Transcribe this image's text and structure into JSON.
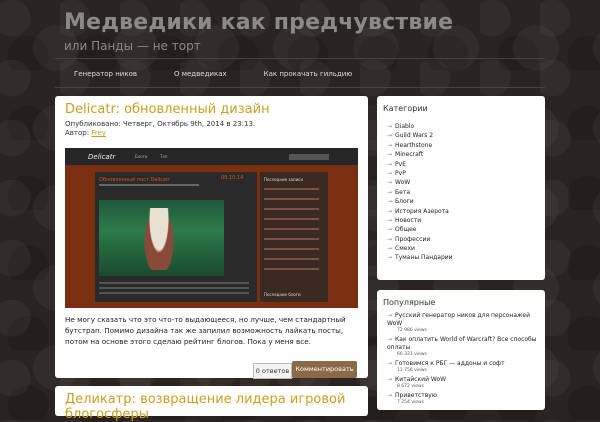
{
  "site": {
    "title": "Медведики как предчувствие",
    "description": "или Панды — не торт"
  },
  "nav": {
    "items": [
      "Генератор ников",
      "О медведиках",
      "Как прокачать гильдию"
    ]
  },
  "post1": {
    "title": "Delicatr: обновленный дизайн",
    "meta_published": "Опубликовано: Четверг, Октябрь 9th, 2014 в 23:13.",
    "meta_author_label": "Автор:",
    "meta_author": "Frey",
    "excerpt": "Не могу сказать что это что-то выдающееся, но лучше, чем стандартный бутстрап. Помимо дизайна так же запилил возможность лайкать посты, потом на основе этого сделаю рейтинг блогов. Пока у меня все.",
    "comments_count": "0 ответов",
    "comment_button": "Комментировать",
    "screenshot": {
      "logo": "Delicatr",
      "nav1": "Блоги",
      "nav2": "Топ",
      "title": "Обновленный пост Delicatr",
      "date": "09.10.14",
      "sidebar_head": "Последние записи",
      "sidebar_head2": "Последние блоги"
    }
  },
  "post2": {
    "title": "Деликатр: возвращение лидера игровой блогосферы"
  },
  "categories": {
    "title": "Категории",
    "items": [
      "Diablo",
      "Guild Wars 2",
      "Hearthstone",
      "Minecraft",
      "PvE",
      "PvP",
      "WoW",
      "Бета",
      "Блоги",
      "История Азерота",
      "Новости",
      "Общее",
      "Профессии",
      "Смехи",
      "Туманы Пандарии"
    ]
  },
  "popular": {
    "title": "Популярные",
    "items": [
      {
        "title": "Русский генератор ников для персонажей WoW",
        "views": "72 986 views"
      },
      {
        "title": "Как оплатить World of Warcraft? Все способы оплаты",
        "views": "66 321 views"
      },
      {
        "title": "Готовимся к РБГ — аддоны и софт",
        "views": "11 756 views"
      },
      {
        "title": "Китайский WoW",
        "views": "8 672 views"
      },
      {
        "title": "Приветствую",
        "views": "7 254 views"
      }
    ]
  },
  "colors": {
    "accent": "#c8a020",
    "button": "#8b6a48",
    "background": "#2a2420"
  }
}
